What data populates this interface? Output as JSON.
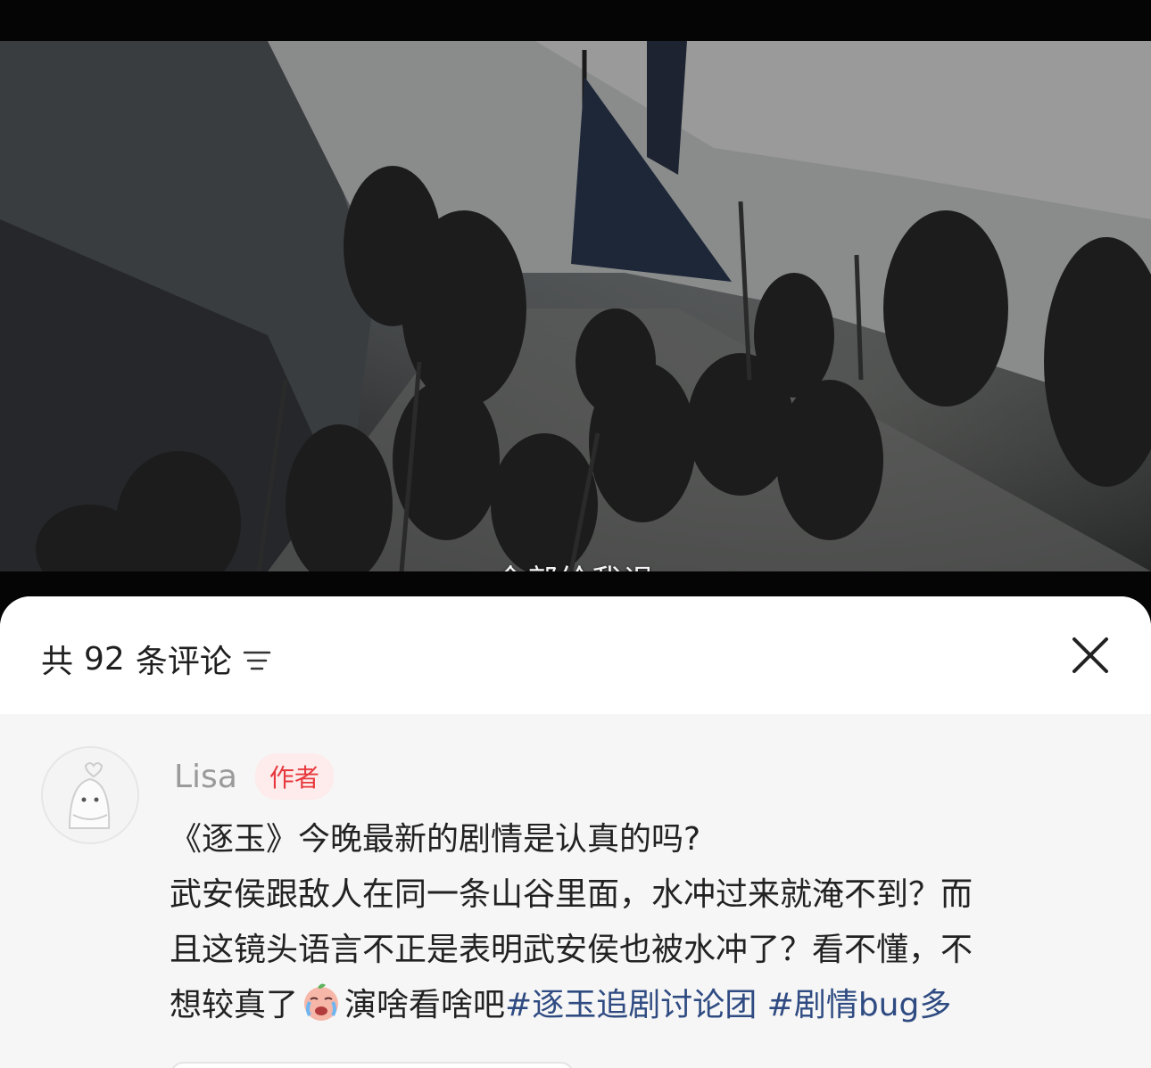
{
  "video": {
    "subtitle": "全部给我退"
  },
  "comments_panel": {
    "count_prefix": "共",
    "count": "92",
    "count_suffix": "条评论",
    "sort_icon": "sort-lines-icon",
    "close_icon": "close-icon"
  },
  "comment": {
    "author": "Lisa",
    "badge": "作者",
    "lines": {
      "l1": "《逐玉》今晚最新的剧情是认真的吗?",
      "l2": "武安侯跟敌人在同一条山谷里面，水冲过来就淹不到？而",
      "l3": "且这镜头语言不正是表明武安侯也被水冲了？看不懂，不",
      "l4a": "想较真了",
      "l4b": "演啥看啥吧",
      "tag1": "#逐玉追剧讨论团",
      "tag2": "#剧情bug多"
    },
    "emoji_icon": "crying-emoji-icon"
  },
  "colors": {
    "accent_badge_bg": "#fdeceb",
    "accent_badge_text": "#e8383d",
    "hashtag": "#2f4b82"
  }
}
